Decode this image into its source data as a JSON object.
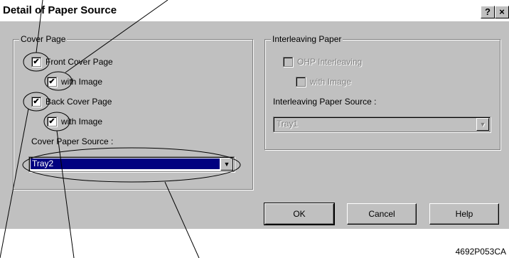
{
  "dialog": {
    "title": "Detail of Paper Source",
    "help_symbol": "?",
    "close_symbol": "×"
  },
  "cover_page": {
    "legend": "Cover Page",
    "front_cover": {
      "label": "Front Cover Page",
      "checked": true
    },
    "front_with_image": {
      "label": "with Image",
      "checked": true
    },
    "back_cover": {
      "label": "Back Cover Page",
      "checked": true
    },
    "back_with_image": {
      "label": "with Image",
      "checked": true
    },
    "source_label": "Cover Paper Source :",
    "source_value": "Tray2"
  },
  "interleaving": {
    "legend": "Interleaving Paper",
    "ohp": {
      "label": "OHP Interleaving",
      "checked": false
    },
    "with_image": {
      "label": "with Image",
      "checked": false
    },
    "source_label": "Interleaving Paper Source :",
    "source_value": "Tray1"
  },
  "buttons": {
    "ok": "OK",
    "cancel": "Cancel",
    "help": "Help"
  },
  "caption": "4692P053CA",
  "check_mark": "✔",
  "arrow_down": "▼"
}
